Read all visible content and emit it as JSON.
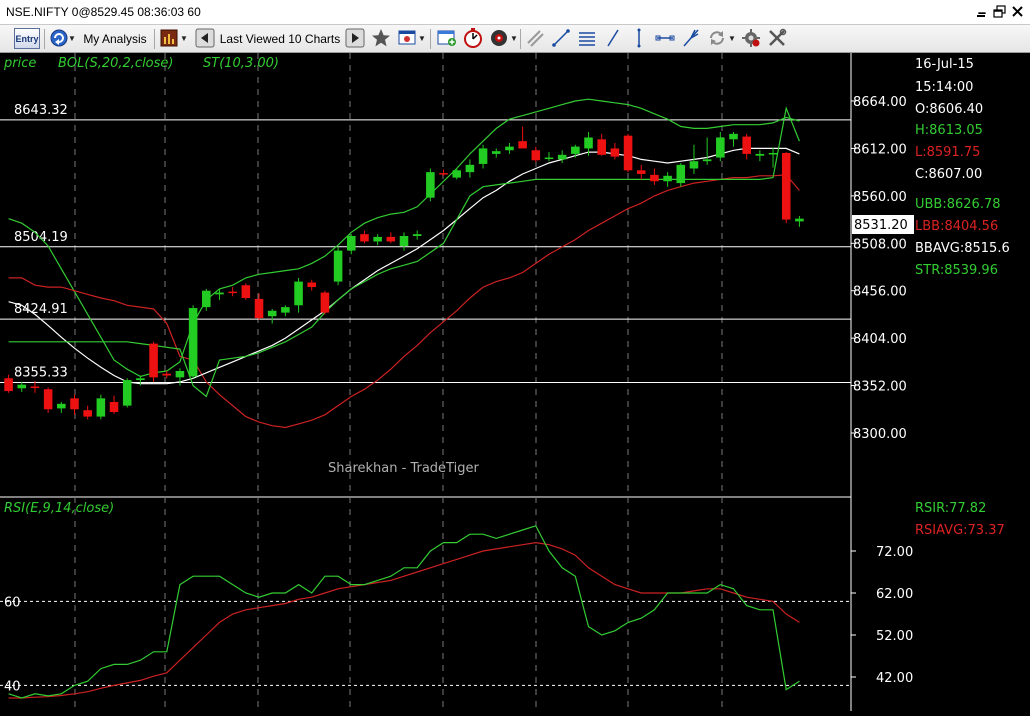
{
  "window": {
    "title": "NSE.NIFTY 0@8529.45 08:36:03 60",
    "buttons": [
      "close-window"
    ]
  },
  "toolbar": {
    "entry_label": "Entry",
    "my_analysis_label": "My Analysis",
    "last_viewed_label": "Last Viewed 10 Charts",
    "icons": [
      "entry-icon",
      "analysis-icon",
      "chart-type-icon",
      "back-arrow-icon",
      "forward-arrow-icon",
      "star-icon",
      "drawing-tools-icon",
      "new-window-icon",
      "stopwatch-icon",
      "speaker-icon",
      "trend-line-icon",
      "line-icon",
      "fibonacci-icon",
      "ray-icon",
      "channel-icon",
      "pitchfork-icon",
      "refresh-icon",
      "settings-gear-icon",
      "tools-icon"
    ]
  },
  "price_panel": {
    "header": {
      "price_label": "price",
      "bol_label": "BOL(S,20,2,close)",
      "st_label": "ST(10,3.00)"
    },
    "levels": [
      {
        "label": "8643.32",
        "value": 8643.32
      },
      {
        "label": "8504.19",
        "value": 8504.19
      },
      {
        "label": "8424.91",
        "value": 8424.91
      },
      {
        "label": "8355.33",
        "value": 8355.33
      }
    ],
    "axis_ticks": [
      "8664.00",
      "8612.00",
      "8560.00",
      "8508.00",
      "8456.00",
      "8404.00",
      "8352.00",
      "8300.00"
    ],
    "axis_tick_values": [
      8664,
      8612,
      8560,
      8508,
      8456,
      8404,
      8352,
      8300
    ],
    "current_price": "8531.20",
    "info": {
      "date": "16-Jul-15",
      "time": "15:14:00",
      "open": "O:8606.40",
      "high": "H:8613.05",
      "low": "L:8591.75",
      "close": "C:8607.00",
      "ubb": "UBB:8626.78",
      "lbb": "LBB:8404.56",
      "bbavg": "BBAVG:8515.6",
      "str": "STR:8539.96"
    },
    "watermark": "Sharekhan - TradeTiger"
  },
  "rsi_panel": {
    "header": "RSI(E,9,14,close)",
    "axis_ticks": [
      "72.00",
      "62.00",
      "52.00",
      "42.00"
    ],
    "axis_tick_values": [
      72,
      62,
      52,
      42
    ],
    "levels": [
      {
        "label": "60",
        "value": 60
      },
      {
        "label": "40",
        "value": 40
      }
    ],
    "info": {
      "rsir": "RSIR:77.82",
      "rsiavg": "RSIAVG:73.37"
    }
  },
  "colors": {
    "background": "#000000",
    "bull": "#22cc22",
    "bear": "#ee1111",
    "bb_upper": "#33cc33",
    "bb_lower": "#cc2222",
    "bb_avg": "#ffffff",
    "rsi": "#33cc33",
    "rsi_avg": "#cc2222",
    "axis_text_white": "#ffffff",
    "info_green": "#33cc33",
    "info_red": "#dd2222"
  },
  "chart_data": [
    {
      "type": "candlestick",
      "title": "NSE.NIFTY",
      "ylim": [
        8260,
        8690
      ],
      "yticks": [
        8664,
        8612,
        8560,
        8508,
        8456,
        8404,
        8352,
        8300
      ],
      "candles": [
        {
          "o": 8360,
          "h": 8364,
          "l": 8344,
          "c": 8346
        },
        {
          "o": 8349,
          "h": 8356,
          "l": 8345,
          "c": 8353
        },
        {
          "o": 8351,
          "h": 8357,
          "l": 8344,
          "c": 8350
        },
        {
          "o": 8348,
          "h": 8350,
          "l": 8322,
          "c": 8326
        },
        {
          "o": 8327,
          "h": 8334,
          "l": 8322,
          "c": 8332
        },
        {
          "o": 8338,
          "h": 8342,
          "l": 8320,
          "c": 8326
        },
        {
          "o": 8325,
          "h": 8330,
          "l": 8315,
          "c": 8318
        },
        {
          "o": 8318,
          "h": 8342,
          "l": 8315,
          "c": 8338
        },
        {
          "o": 8334,
          "h": 8341,
          "l": 8321,
          "c": 8323
        },
        {
          "o": 8330,
          "h": 8360,
          "l": 8328,
          "c": 8358
        },
        {
          "o": 8358,
          "h": 8363,
          "l": 8352,
          "c": 8360
        },
        {
          "o": 8398,
          "h": 8400,
          "l": 8356,
          "c": 8361
        },
        {
          "o": 8365,
          "h": 8368,
          "l": 8360,
          "c": 8363
        },
        {
          "o": 8361,
          "h": 8371,
          "l": 8352,
          "c": 8368
        },
        {
          "o": 8362,
          "h": 8440,
          "l": 8360,
          "c": 8437
        },
        {
          "o": 8438,
          "h": 8458,
          "l": 8434,
          "c": 8456
        },
        {
          "o": 8452,
          "h": 8458,
          "l": 8446,
          "c": 8454
        },
        {
          "o": 8455,
          "h": 8460,
          "l": 8450,
          "c": 8454
        },
        {
          "o": 8462,
          "h": 8464,
          "l": 8446,
          "c": 8448
        },
        {
          "o": 8447,
          "h": 8453,
          "l": 8424,
          "c": 8426
        },
        {
          "o": 8428,
          "h": 8436,
          "l": 8420,
          "c": 8434
        },
        {
          "o": 8432,
          "h": 8440,
          "l": 8428,
          "c": 8438
        },
        {
          "o": 8440,
          "h": 8470,
          "l": 8432,
          "c": 8466
        },
        {
          "o": 8465,
          "h": 8468,
          "l": 8456,
          "c": 8460
        },
        {
          "o": 8454,
          "h": 8456,
          "l": 8430,
          "c": 8432
        },
        {
          "o": 8466,
          "h": 8504,
          "l": 8462,
          "c": 8500
        },
        {
          "o": 8500,
          "h": 8518,
          "l": 8496,
          "c": 8516
        },
        {
          "o": 8518,
          "h": 8522,
          "l": 8508,
          "c": 8510
        },
        {
          "o": 8510,
          "h": 8518,
          "l": 8506,
          "c": 8515
        },
        {
          "o": 8515,
          "h": 8520,
          "l": 8508,
          "c": 8510
        },
        {
          "o": 8505,
          "h": 8520,
          "l": 8500,
          "c": 8516
        },
        {
          "o": 8516,
          "h": 8522,
          "l": 8512,
          "c": 8518
        },
        {
          "o": 8558,
          "h": 8590,
          "l": 8554,
          "c": 8586
        },
        {
          "o": 8585,
          "h": 8589,
          "l": 8582,
          "c": 8584
        },
        {
          "o": 8580,
          "h": 8590,
          "l": 8578,
          "c": 8588
        },
        {
          "o": 8586,
          "h": 8600,
          "l": 8580,
          "c": 8594
        },
        {
          "o": 8595,
          "h": 8616,
          "l": 8590,
          "c": 8612
        },
        {
          "o": 8606,
          "h": 8612,
          "l": 8602,
          "c": 8609
        },
        {
          "o": 8610,
          "h": 8618,
          "l": 8606,
          "c": 8614
        },
        {
          "o": 8620,
          "h": 8636,
          "l": 8612,
          "c": 8612
        },
        {
          "o": 8610,
          "h": 8614,
          "l": 8597,
          "c": 8599
        },
        {
          "o": 8602,
          "h": 8608,
          "l": 8598,
          "c": 8602
        },
        {
          "o": 8600,
          "h": 8610,
          "l": 8596,
          "c": 8605
        },
        {
          "o": 8606,
          "h": 8616,
          "l": 8602,
          "c": 8614
        },
        {
          "o": 8612,
          "h": 8630,
          "l": 8604,
          "c": 8624
        },
        {
          "o": 8622,
          "h": 8628,
          "l": 8604,
          "c": 8605
        },
        {
          "o": 8612,
          "h": 8618,
          "l": 8600,
          "c": 8603
        },
        {
          "o": 8626,
          "h": 8628,
          "l": 8586,
          "c": 8588
        },
        {
          "o": 8588,
          "h": 8594,
          "l": 8578,
          "c": 8584
        },
        {
          "o": 8583,
          "h": 8590,
          "l": 8572,
          "c": 8576
        },
        {
          "o": 8576,
          "h": 8586,
          "l": 8570,
          "c": 8582
        },
        {
          "o": 8574,
          "h": 8596,
          "l": 8570,
          "c": 8594
        },
        {
          "o": 8590,
          "h": 8616,
          "l": 8584,
          "c": 8598
        },
        {
          "o": 8598,
          "h": 8624,
          "l": 8594,
          "c": 8600
        },
        {
          "o": 8602,
          "h": 8630,
          "l": 8598,
          "c": 8624
        },
        {
          "o": 8622,
          "h": 8630,
          "l": 8614,
          "c": 8628
        },
        {
          "o": 8625,
          "h": 8628,
          "l": 8600,
          "c": 8606
        },
        {
          "o": 8604,
          "h": 8610,
          "l": 8598,
          "c": 8606
        },
        {
          "o": 8606,
          "h": 8613,
          "l": 8591,
          "c": 8607
        },
        {
          "o": 8607,
          "h": 8608,
          "l": 8530,
          "c": 8534
        },
        {
          "o": 8532,
          "h": 8538,
          "l": 8526,
          "c": 8535
        }
      ],
      "bb_upper": [
        8535,
        8530,
        8520,
        8505,
        8480,
        8455,
        8430,
        8405,
        8380,
        8370,
        8362,
        8366,
        8368,
        8378,
        8420,
        8446,
        8458,
        8462,
        8470,
        8474,
        8476,
        8478,
        8480,
        8486,
        8494,
        8506,
        8520,
        8530,
        8536,
        8540,
        8542,
        8548,
        8562,
        8576,
        8590,
        8606,
        8620,
        8634,
        8644,
        8648,
        8652,
        8656,
        8660,
        8664,
        8666,
        8664,
        8662,
        8660,
        8656,
        8650,
        8644,
        8636,
        8634,
        8634,
        8636,
        8638,
        8638,
        8638,
        8640,
        8646,
        8642
      ],
      "bb_lower": [
        8470,
        8470,
        8462,
        8460,
        8460,
        8456,
        8452,
        8448,
        8445,
        8440,
        8438,
        8436,
        8420,
        8384,
        8380,
        8356,
        8342,
        8330,
        8318,
        8312,
        8308,
        8306,
        8310,
        8314,
        8320,
        8330,
        8340,
        8348,
        8358,
        8370,
        8384,
        8396,
        8410,
        8422,
        8434,
        8448,
        8460,
        8466,
        8470,
        8476,
        8486,
        8496,
        8504,
        8512,
        8522,
        8530,
        8538,
        8546,
        8552,
        8560,
        8566,
        8570,
        8574,
        8576,
        8578,
        8580,
        8580,
        8582,
        8582,
        8583,
        8566
      ],
      "bb_avg": [
        8444,
        8440,
        8430,
        8418,
        8405,
        8393,
        8382,
        8372,
        8363,
        8356,
        8354,
        8354,
        8354,
        8356,
        8360,
        8366,
        8372,
        8378,
        8384,
        8390,
        8396,
        8404,
        8414,
        8424,
        8434,
        8446,
        8458,
        8468,
        8478,
        8486,
        8494,
        8502,
        8512,
        8522,
        8534,
        8546,
        8558,
        8566,
        8576,
        8584,
        8590,
        8596,
        8600,
        8604,
        8608,
        8608,
        8606,
        8604,
        8600,
        8598,
        8596,
        8598,
        8600,
        8602,
        8606,
        8610,
        8612,
        8612,
        8612,
        8612,
        8606
      ],
      "supertrend": [
        8400,
        8400,
        8400,
        8400,
        8400,
        8400,
        8400,
        8400,
        8400,
        8400,
        8398,
        8396,
        8394,
        8392,
        8352,
        8340,
        8380,
        8382,
        8384,
        8388,
        8394,
        8400,
        8408,
        8416,
        8432,
        8446,
        8458,
        8466,
        8474,
        8480,
        8484,
        8488,
        8498,
        8508,
        8534,
        8560,
        8570,
        8572,
        8574,
        8576,
        8578,
        8578,
        8578,
        8578,
        8578,
        8578,
        8578,
        8578,
        8578,
        8578,
        8578,
        8578,
        8578,
        8578,
        8578,
        8578,
        8578,
        8578,
        8580,
        8656,
        8620
      ]
    },
    {
      "type": "line",
      "title": "RSI(E,9,14,close)",
      "ylim": [
        37,
        78
      ],
      "yticks": [
        72,
        62,
        52,
        42
      ],
      "series": [
        {
          "name": "RSIR",
          "values": [
            38,
            37,
            38,
            37.5,
            38,
            40,
            41,
            44,
            45,
            45,
            46,
            48,
            48,
            64,
            66,
            66,
            66,
            64,
            62,
            61,
            62,
            62,
            64,
            62,
            66,
            66,
            64,
            64,
            65,
            66,
            68,
            68,
            72,
            74,
            74,
            76,
            76,
            75,
            76,
            77,
            78,
            72,
            68,
            66,
            54,
            52,
            53,
            55,
            56,
            58,
            62,
            62,
            62,
            62,
            64,
            63,
            59,
            58,
            58,
            39,
            41
          ]
        },
        {
          "name": "RSIAVG",
          "values": [
            37,
            37,
            37.2,
            37.3,
            37.6,
            38,
            38.5,
            39.3,
            40,
            40.6,
            41.2,
            42.2,
            43,
            46,
            49,
            52,
            55,
            57,
            58,
            58.5,
            59,
            59.5,
            60.5,
            61,
            62,
            63,
            63.5,
            64,
            64.5,
            65,
            66,
            67,
            68,
            69,
            70,
            71,
            72,
            72.5,
            73,
            73.5,
            74,
            73.5,
            72.5,
            71,
            68,
            66,
            64,
            63,
            62,
            62,
            62,
            62,
            62.5,
            63,
            63,
            62,
            61,
            60.5,
            60,
            57,
            55
          ]
        }
      ],
      "reference_levels": [
        60,
        40
      ]
    }
  ]
}
